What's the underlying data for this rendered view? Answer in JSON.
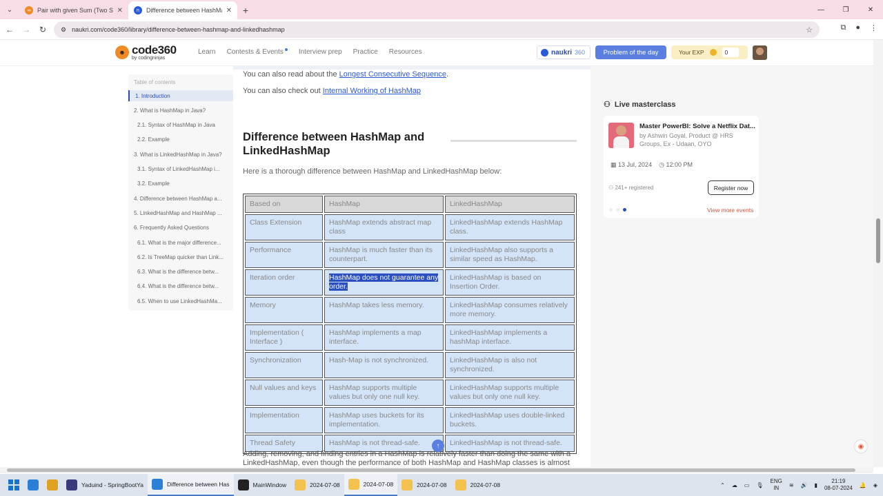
{
  "browser": {
    "tabs": [
      {
        "title": "Pair with given Sum (Two Sum)",
        "active": false
      },
      {
        "title": "Difference between HashMap a",
        "active": true
      }
    ],
    "new_tab": "+",
    "url": "naukri.com/code360/library/difference-between-hashmap-and-linkedhashmap"
  },
  "site": {
    "logo_main": "code360",
    "logo_sub": "by codingninjas",
    "menu": [
      "Learn",
      "Contests & Events",
      "Interview prep",
      "Practice",
      "Resources"
    ],
    "naukri_label": "naukri",
    "naukri_suffix": "360",
    "potd": "Problem of the day",
    "exp_label": "Your EXP",
    "exp_value": "0"
  },
  "toc": {
    "title": "Table of contents",
    "items": [
      {
        "label": "1.   Introduction",
        "level": 1,
        "active": true
      },
      {
        "label": "2.   What is HashMap in Java?",
        "level": 1
      },
      {
        "label": "2.1.   Syntax of HashMap in Java",
        "level": 2
      },
      {
        "label": "2.2.   Example",
        "level": 2
      },
      {
        "label": "3.   What is LinkedHashMap in Java?",
        "level": 1
      },
      {
        "label": "3.1.   Syntax of LinkedHashMap i...",
        "level": 2
      },
      {
        "label": "3.2.   Example",
        "level": 2
      },
      {
        "label": "4.   Difference between HashMap a...",
        "level": 1
      },
      {
        "label": "5.   LinkedHashMap and HashMap ...",
        "level": 1
      },
      {
        "label": "6.   Frequently Asked Questions",
        "level": 1
      },
      {
        "label": "6.1.   What is the major difference...",
        "level": 2
      },
      {
        "label": "6.2.   Is TreeMap quicker than Link...",
        "level": 2
      },
      {
        "label": "6.3.   What is the difference betw...",
        "level": 2
      },
      {
        "label": "6.4.   What is the difference betw...",
        "level": 2
      },
      {
        "label": "6.5.   When to use LinkedHashMa...",
        "level": 2
      }
    ]
  },
  "article": {
    "read_prefix": "You can also read about the ",
    "read_link": "Longest Consecutive Sequence",
    "read_suffix": ".",
    "check_prefix": "You can also check out ",
    "check_link": "Internal Working of HashMap",
    "heading": "Difference between HashMap and LinkedHashMap",
    "intro": "Here is a thorough difference between HashMap and LinkedHashMap below:",
    "table": {
      "headers": [
        "Based on",
        "HashMap",
        "LinkedHashMap"
      ],
      "rows": [
        [
          "Class Extension",
          "HashMap extends abstract map class",
          "LinkedHashMap extends HashMap class."
        ],
        [
          "Performance",
          "HashMap is much faster than its counterpart.",
          "LinkedHashMap also supports a similar speed as HashMap."
        ],
        [
          "Iteration order",
          "HashMap does not guarantee any order.",
          "LinkedHashMap is based on Insertion Order."
        ],
        [
          "Memory",
          "HashMap takes less memory.",
          "LinkedHashMap consumes relatively more memory."
        ],
        [
          "Implementation ( Interface )",
          "HashMap implements a map interface.",
          "LinkedHashMap implements a hashMap interface."
        ],
        [
          "Synchronization",
          "Hash-Map is not synchronized.",
          "LinkedHashMap is also not synchronized."
        ],
        [
          "Null values and keys",
          "HashMap supports multiple values but only one null key.",
          "LinkedHashMap supports multiple values but only one null key."
        ],
        [
          "Implementation",
          "HashMap uses buckets for its implementation.",
          "LinkedHashMap uses double-linked buckets."
        ],
        [
          "Thread Safety",
          "HashMap is not thread-safe.",
          "LinkedHashMap is not thread-safe."
        ]
      ],
      "selected_cell": {
        "row": 2,
        "col": 1
      }
    },
    "after_text": "Adding, removing, and finding entries in a HashMap is relatively faster than doing the same with a LinkedHashMap, even though the performance of both HashMap and HashMap classes is almost"
  },
  "masterclass": {
    "title": "Live masterclass",
    "event": "Master PowerBI: Solve a Netflix Dat...",
    "by": "by Ashwin Goyal, Product @ HRS Groups, Ex - Udaan, OYO",
    "date": "13 Jul, 2024",
    "time": "12:00 PM",
    "registered": "241+ registered",
    "register_btn": "Register now",
    "more": "View more events"
  },
  "taskbar": {
    "items": [
      {
        "label": "",
        "color": "#2a7fd6"
      },
      {
        "label": "",
        "color": "#e0a020"
      },
      {
        "label": "Yaduind - SpringBootYa",
        "color": "#3a3a7a"
      },
      {
        "label": "Difference between Has",
        "color": "#2a7fd6",
        "active": true
      },
      {
        "label": "MainWindow",
        "color": "#222"
      },
      {
        "label": "2024-07-08",
        "color": "#f2c14e"
      },
      {
        "label": "2024-07-08",
        "color": "#f2c14e",
        "active": true
      },
      {
        "label": "2024-07-08",
        "color": "#f2c14e"
      },
      {
        "label": "2024-07-08",
        "color": "#f2c14e"
      }
    ],
    "lang_top": "ENG",
    "lang_bottom": "IN",
    "time": "21:19",
    "date": "08-07-2024"
  },
  "colors": {
    "accent": "#2a4ab8",
    "table_cell": "#d3e3f8",
    "selection": "#2a4fc2"
  }
}
